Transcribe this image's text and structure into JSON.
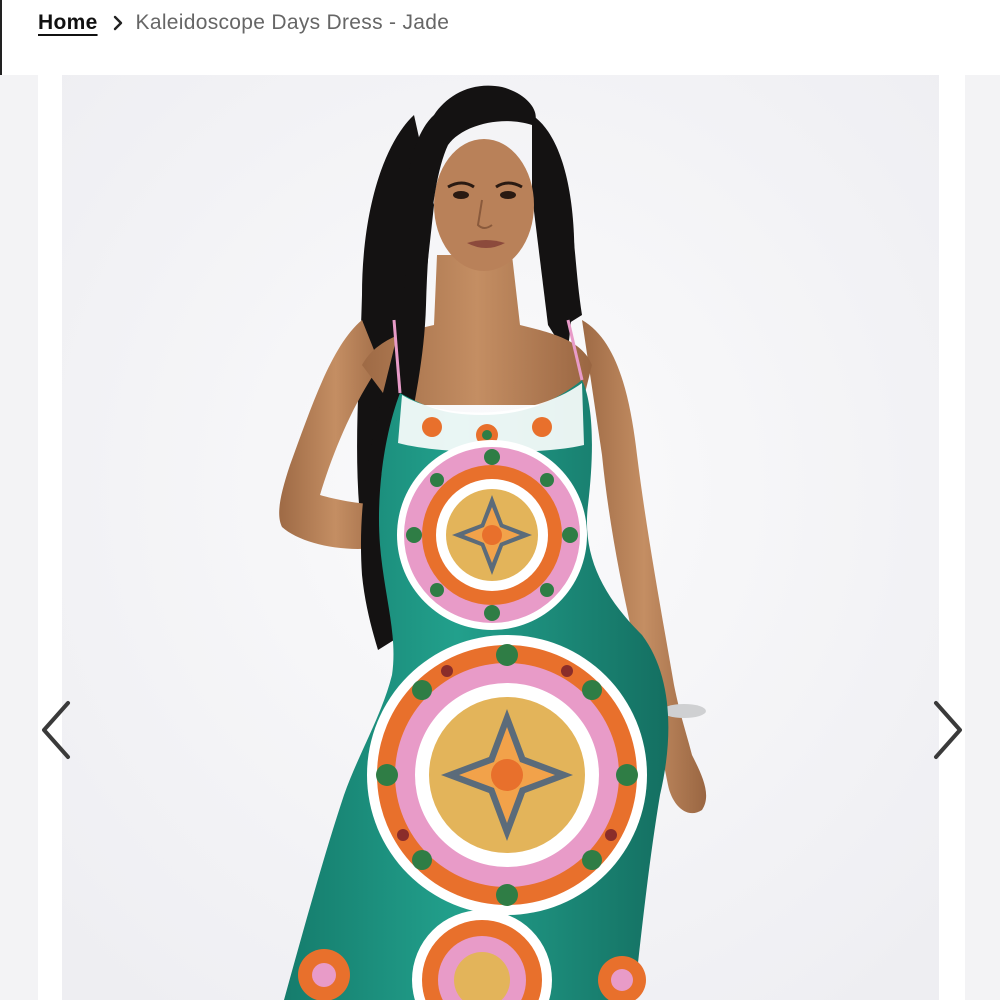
{
  "breadcrumb": {
    "home_label": "Home",
    "separator_icon": "chevron-right-icon",
    "current_label": "Kaleidoscope Days Dress - Jade"
  },
  "gallery": {
    "image_alt": "Kaleidoscope Days Dress - Jade",
    "prev_icon": "chevron-left-icon",
    "next_icon": "chevron-right-icon"
  },
  "colors": {
    "dress_jade": "#1f9a86",
    "print_orange": "#e8702c",
    "print_pink": "#e89bc8",
    "print_gold": "#e3b45a",
    "skin": "#b9835a",
    "hair": "#141212",
    "slide_background": "#f6f6f8",
    "arrow": "#3a3a3a"
  }
}
